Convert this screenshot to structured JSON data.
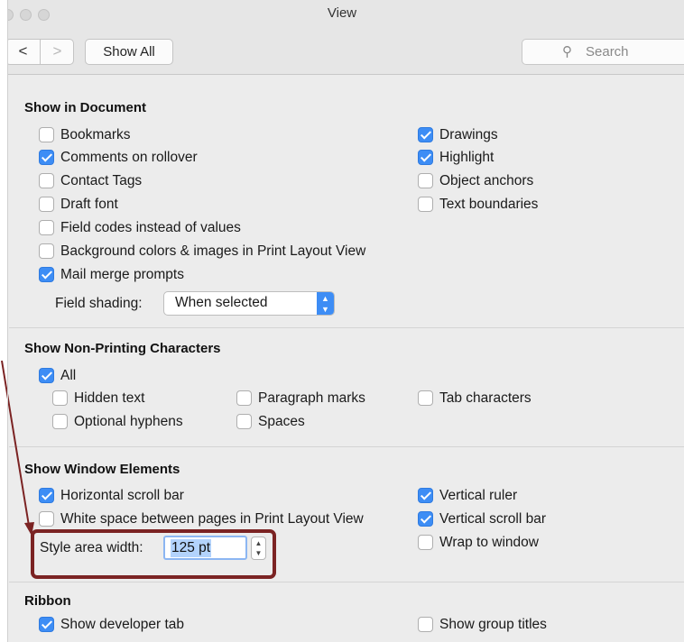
{
  "window": {
    "title": "View"
  },
  "toolbar": {
    "back_label": "<",
    "forward_label": ">",
    "show_all_label": "Show All",
    "search_placeholder": "Search",
    "search_icon": "magnifier-icon"
  },
  "sections": {
    "show_in_document": {
      "heading": "Show in Document",
      "items": [
        {
          "label": "Bookmarks",
          "checked": false
        },
        {
          "label": "Comments on rollover",
          "checked": true
        },
        {
          "label": "Contact Tags",
          "checked": false
        },
        {
          "label": "Draft font",
          "checked": false
        },
        {
          "label": "Field codes instead of values",
          "checked": false
        },
        {
          "label": "Background colors & images in Print Layout View",
          "checked": false
        },
        {
          "label": "Mail merge prompts",
          "checked": true
        },
        {
          "label": "Drawings",
          "checked": true
        },
        {
          "label": "Highlight",
          "checked": true
        },
        {
          "label": "Object anchors",
          "checked": false
        },
        {
          "label": "Text boundaries",
          "checked": false
        }
      ],
      "field_shading_label": "Field shading:",
      "field_shading_value": "When selected"
    },
    "non_printing": {
      "heading": "Show Non-Printing Characters",
      "items": [
        {
          "label": "All",
          "checked": true
        },
        {
          "label": "Hidden text",
          "checked": false
        },
        {
          "label": "Optional hyphens",
          "checked": false
        },
        {
          "label": "Paragraph marks",
          "checked": false
        },
        {
          "label": "Spaces",
          "checked": false
        },
        {
          "label": "Tab characters",
          "checked": false
        }
      ]
    },
    "window_elements": {
      "heading": "Show Window Elements",
      "items": [
        {
          "label": "Horizontal scroll bar",
          "checked": true
        },
        {
          "label": "White space between pages in Print Layout View",
          "checked": false
        },
        {
          "label": "Vertical ruler",
          "checked": true
        },
        {
          "label": "Vertical scroll bar",
          "checked": true
        },
        {
          "label": "Wrap to window",
          "checked": false
        }
      ],
      "style_area_label": "Style area width:",
      "style_area_value": "125 pt"
    },
    "ribbon": {
      "heading": "Ribbon",
      "items": [
        {
          "label": "Show developer tab",
          "checked": true
        },
        {
          "label": "Show group titles",
          "checked": false
        }
      ]
    }
  },
  "annotation": {
    "color": "#7b2323"
  },
  "colors": {
    "checkbox_checked": "#3d8df5",
    "window_bg": "#ececec"
  }
}
